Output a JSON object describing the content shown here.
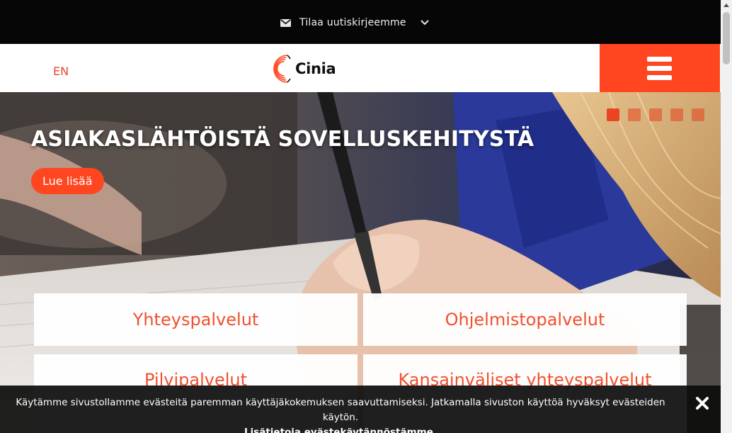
{
  "topbar": {
    "newsletter_label": "Tilaa uutiskirjeemme",
    "icons": [
      "mail-icon",
      "chevron-down-icon"
    ]
  },
  "header": {
    "language_link": "EN",
    "logo_text": "Cinia",
    "menu_icon": "hamburger-menu-icon",
    "brand_color": "#ff4621"
  },
  "hero": {
    "title": "ASIAKASLÄHTÖISTÄ SOVELLUSKEHITYSTÄ",
    "button_label": "Lue lisää",
    "slide_count": 5,
    "active_slide": 1
  },
  "services": [
    {
      "label": "Yhteyspalvelut"
    },
    {
      "label": "Ohjelmistopalvelut"
    },
    {
      "label": "Pilvipalvelut"
    },
    {
      "label": "Kansainväliset yhteyspalvelut"
    }
  ],
  "cookie_banner": {
    "message": "Käytämme sivustollamme evästeitä paremman käyttäjäkokemuksen saavuttamiseksi. Jatkamalla sivuston käyttöä hyväksyt evästeiden käytön.",
    "link_label": "Lisätietoja evästekäytännöstämme.",
    "close_icon": "close-icon"
  },
  "colors": {
    "accent": "#ff4621",
    "topbar_bg": "#060606",
    "tile_text": "#f0502e"
  }
}
